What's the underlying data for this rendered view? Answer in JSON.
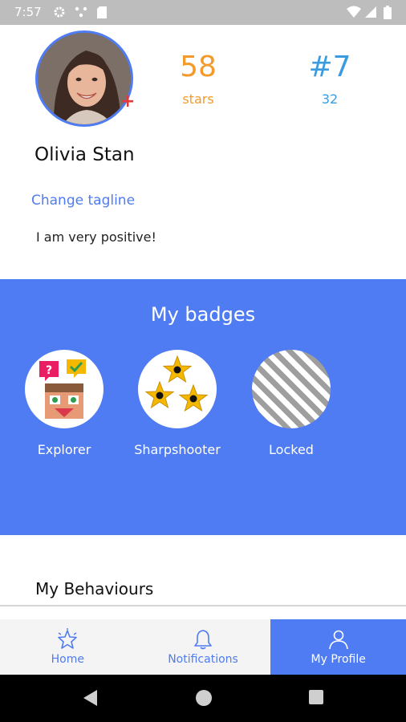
{
  "status_bar": {
    "time": "7:57",
    "icons": [
      "gear-icon",
      "network-dots-icon",
      "sd-card-icon",
      "wifi-icon",
      "signal-icon",
      "battery-icon"
    ]
  },
  "profile": {
    "name": "Olivia Stan",
    "stars_value": "58",
    "stars_label": "stars",
    "rank_value": "#7",
    "rank_label": "32",
    "change_tagline": "Change tagline",
    "tagline": "I am very positive!"
  },
  "badges": {
    "title": "My badges",
    "items": [
      {
        "label": "Explorer"
      },
      {
        "label": "Sharpshooter"
      },
      {
        "label": "Locked"
      }
    ]
  },
  "behaviours": {
    "title": "My Behaviours"
  },
  "bottom_nav": {
    "items": [
      {
        "label": "Home",
        "icon": "star-icon"
      },
      {
        "label": "Notifications",
        "icon": "bell-icon"
      },
      {
        "label": "My Profile",
        "icon": "person-icon",
        "active": true
      }
    ]
  },
  "colors": {
    "accent": "#4f7cf2",
    "stars": "#f39a2b",
    "rank": "#3a9be0",
    "status_bar": "#bdbdbd"
  }
}
